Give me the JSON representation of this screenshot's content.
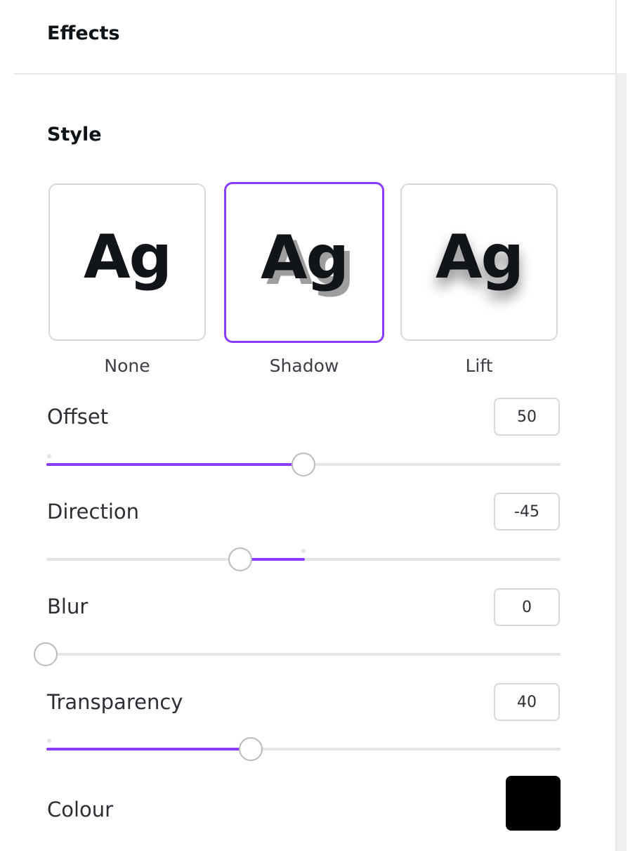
{
  "header": {
    "title": "Effects"
  },
  "style_section": {
    "title": "Style",
    "options": [
      {
        "preview": "Ag",
        "label": "None"
      },
      {
        "preview": "Ag",
        "label": "Shadow",
        "selected": true
      },
      {
        "preview": "Ag",
        "label": "Lift"
      }
    ]
  },
  "controls": {
    "offset": {
      "label": "Offset",
      "value": "50"
    },
    "direction": {
      "label": "Direction",
      "value": "-45"
    },
    "blur": {
      "label": "Blur",
      "value": "0"
    },
    "transparency": {
      "label": "Transparency",
      "value": "40"
    },
    "colour": {
      "label": "Colour",
      "swatch": "#000000"
    }
  },
  "colors": {
    "accent": "#8b3dff",
    "border": "#d7d8db",
    "track": "#e3e4e6"
  }
}
